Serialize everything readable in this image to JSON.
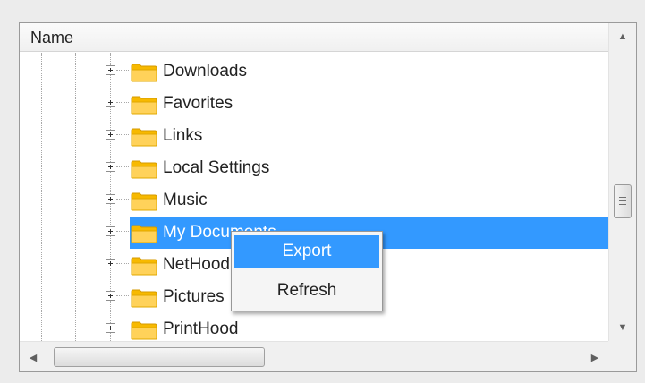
{
  "tree": {
    "column_header": "Name",
    "items": [
      {
        "label": "Downloads",
        "icon": "folder-icon",
        "expandable": true,
        "selected": false
      },
      {
        "label": "Favorites",
        "icon": "folder-icon",
        "expandable": true,
        "selected": false
      },
      {
        "label": "Links",
        "icon": "folder-icon",
        "expandable": true,
        "selected": false
      },
      {
        "label": "Local Settings",
        "icon": "folder-icon",
        "expandable": true,
        "selected": false
      },
      {
        "label": "Music",
        "icon": "folder-icon",
        "expandable": true,
        "selected": false
      },
      {
        "label": "My Documents",
        "icon": "folder-icon",
        "expandable": true,
        "selected": true
      },
      {
        "label": "NetHood",
        "icon": "folder-icon",
        "expandable": true,
        "selected": false
      },
      {
        "label": "Pictures",
        "icon": "folder-icon",
        "expandable": true,
        "selected": false
      },
      {
        "label": "PrintHood",
        "icon": "folder-icon",
        "expandable": true,
        "selected": false
      }
    ]
  },
  "context_menu": {
    "items": [
      {
        "label": "Export",
        "highlighted": true
      },
      {
        "label": "Refresh",
        "highlighted": false
      }
    ]
  },
  "scrollbars": {
    "vertical_up_icon": "arrow-up-icon",
    "vertical_down_icon": "arrow-down-icon",
    "horizontal_left_icon": "arrow-left-icon",
    "horizontal_right_icon": "arrow-right-icon"
  },
  "colors": {
    "selection": "#3399ff",
    "folder_body": "#f7b900",
    "folder_front": "#ffd25a"
  }
}
